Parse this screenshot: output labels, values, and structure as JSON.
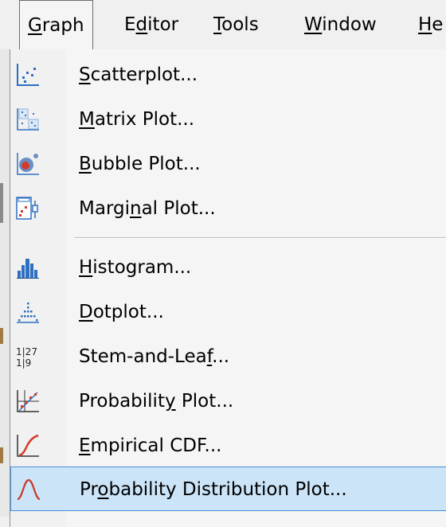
{
  "menubar": {
    "items": [
      {
        "pre": "",
        "mn": "G",
        "post": "raph"
      },
      {
        "pre": "E",
        "mn": "d",
        "post": "itor"
      },
      {
        "pre": "",
        "mn": "T",
        "post": "ools"
      },
      {
        "pre": "",
        "mn": "W",
        "post": "indow"
      },
      {
        "pre": "",
        "mn": "H",
        "post": "e"
      }
    ]
  },
  "menu": {
    "group1": [
      {
        "pre": "",
        "mn": "S",
        "post": "catterplot...",
        "icon": "scatterplot-icon"
      },
      {
        "pre": "",
        "mn": "M",
        "post": "atrix Plot...",
        "icon": "matrix-plot-icon"
      },
      {
        "pre": "",
        "mn": "B",
        "post": "ubble Plot...",
        "icon": "bubble-plot-icon"
      },
      {
        "pre": "Margi",
        "mn": "n",
        "post": "al Plot...",
        "icon": "marginal-plot-icon"
      }
    ],
    "group2": [
      {
        "pre": "",
        "mn": "H",
        "post": "istogram...",
        "icon": "histogram-icon"
      },
      {
        "pre": "",
        "mn": "D",
        "post": "otplot...",
        "icon": "dotplot-icon"
      },
      {
        "pre": "Stem-and-Lea",
        "mn": "f",
        "post": "...",
        "icon": "stem-and-leaf-icon",
        "icon_text_top": "1|27",
        "icon_text_bottom": "1|9"
      },
      {
        "pre": "Probabilit",
        "mn": "y",
        "post": " Plot...",
        "icon": "probability-plot-icon"
      },
      {
        "pre": "",
        "mn": "E",
        "post": "mpirical CDF...",
        "icon": "empirical-cdf-icon"
      },
      {
        "pre": "Pr",
        "mn": "o",
        "post": "bability Distribution Plot...",
        "icon": "probability-distribution-icon"
      }
    ]
  },
  "colors": {
    "selected_bg": "#cce4f7",
    "selected_border": "#4a90d9",
    "icon_blue": "#2f6fc0",
    "icon_red": "#d23b2a"
  }
}
